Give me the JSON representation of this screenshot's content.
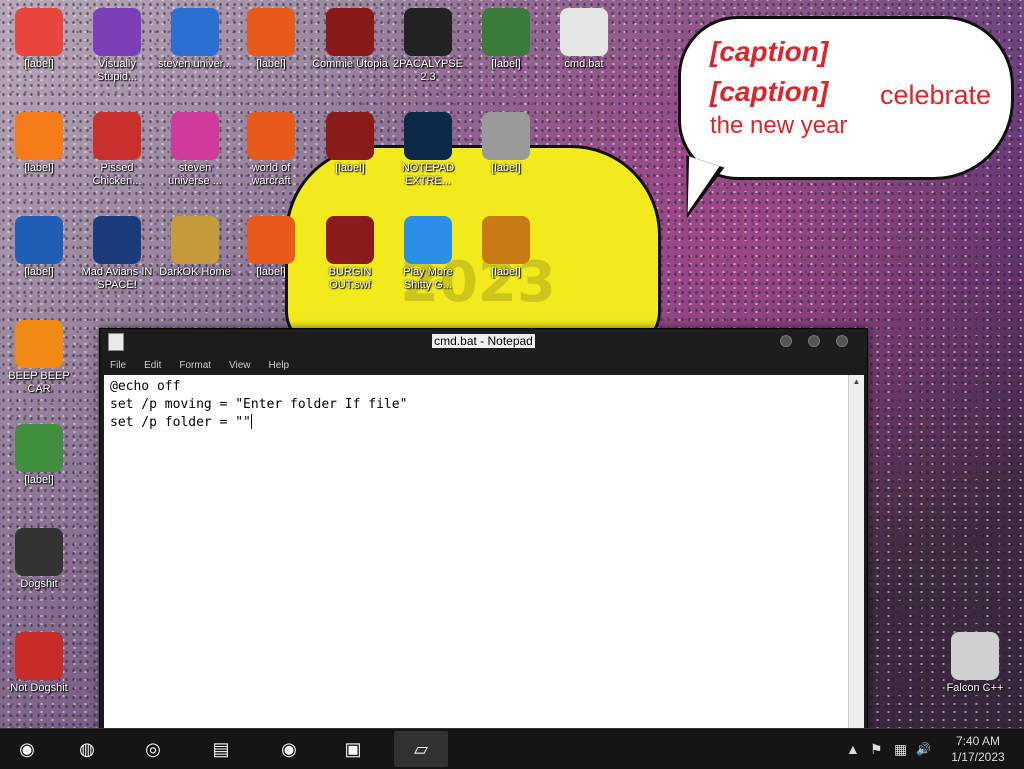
{
  "desktop": {
    "icons": [
      {
        "label": "[label]",
        "icon": "chrome-icon",
        "color": "#e8453c"
      },
      {
        "label": "Visually Stupid...",
        "icon": "visual-studio-icon",
        "color": "#7b3fb8"
      },
      {
        "label": "steven univer...",
        "icon": "app-icon",
        "color": "#2a6fd1"
      },
      {
        "label": "[label]",
        "icon": "app-icon",
        "color": "#e85a1a"
      },
      {
        "label": "Commie Utopia",
        "icon": "app-icon",
        "color": "#8a1a1a"
      },
      {
        "label": "2PACALYPSE 2.3",
        "icon": "terminal-icon",
        "color": "#222222"
      },
      {
        "label": "[label]",
        "icon": "app-icon",
        "color": "#3a7a3a"
      },
      {
        "label": "cmd.bat",
        "icon": "batch-file-icon",
        "color": "#e6e6e6"
      },
      {
        "label": "[label]",
        "icon": "firefox-icon",
        "color": "#f57a18"
      },
      {
        "label": "Pissed Chicken...",
        "icon": "game-icon",
        "color": "#c9302c"
      },
      {
        "label": "steven universe ...",
        "icon": "app-icon",
        "color": "#d03a9a"
      },
      {
        "label": "world of warcraft",
        "icon": "app-icon",
        "color": "#e85a1a"
      },
      {
        "label": "[label]",
        "icon": "flash-icon",
        "color": "#8b1a1a"
      },
      {
        "label": "NOTEPAD EXTRE...",
        "icon": "notepad-icon",
        "color": "#0b2a4a"
      },
      {
        "label": "[label]",
        "icon": "app-icon",
        "color": "#9a9a9a"
      },
      {
        "label": "[label]",
        "icon": "app-icon",
        "color": "#1f5fb5"
      },
      {
        "label": "Mad Avians IN SPACE!",
        "icon": "game-icon",
        "color": "#1b3c7a"
      },
      {
        "label": "DarkOK Home",
        "icon": "money-bag-icon",
        "color": "#c49a3a"
      },
      {
        "label": "[label]",
        "icon": "app-icon",
        "color": "#e85a1a"
      },
      {
        "label": "BURGIN OUT.swf",
        "icon": "flash-icon",
        "color": "#8b1a1a"
      },
      {
        "label": "Play More Shitty G...",
        "icon": "popcap-icon",
        "color": "#2b8fe6"
      },
      {
        "label": "[label]",
        "icon": "app-icon",
        "color": "#c77b12"
      },
      {
        "label": "BEEP BEEP CAR",
        "icon": "vlc-icon",
        "color": "#f08a14"
      },
      {
        "label": "[label]",
        "icon": "hex-editor-icon",
        "color": "#3f8f3f"
      },
      {
        "label": "Dogshit",
        "icon": "app-icon",
        "color": "#333333"
      },
      {
        "label": "Not Dogshit",
        "icon": "devcpp-icon",
        "color": "#c92a2a"
      },
      {
        "label": "Falcon C++",
        "icon": "recycle-bin-icon",
        "color": "#d0d0d0"
      }
    ],
    "bubble": {
      "line1": "[caption]",
      "line2": "[caption]",
      "celebrate": "celebrate",
      "line3": "the new year"
    },
    "year_text": "2023"
  },
  "notepad": {
    "title": "cmd.bat - Notepad",
    "menu": [
      "File",
      "Edit",
      "Format",
      "View",
      "Help"
    ],
    "lines": [
      "@echo off",
      "set /p moving = \"Enter folder If file\"",
      "set /p folder = \"\""
    ]
  },
  "taskbar": {
    "apps": [
      {
        "name": "chrome-icon",
        "glyph": "◉"
      },
      {
        "name": "firefox-icon",
        "glyph": "◍"
      },
      {
        "name": "app-icon",
        "glyph": "◎"
      },
      {
        "name": "folder-icon",
        "glyph": "▤"
      },
      {
        "name": "chrome-icon",
        "glyph": "◉"
      },
      {
        "name": "terminal-icon",
        "glyph": "▣"
      },
      {
        "name": "notepad-icon",
        "glyph": "▱"
      }
    ],
    "tray": {
      "chevron": "▲",
      "flag": "⚑",
      "network": "▦",
      "volume": "🔊"
    },
    "time": "7:40 AM",
    "date": "1/17/2023"
  }
}
